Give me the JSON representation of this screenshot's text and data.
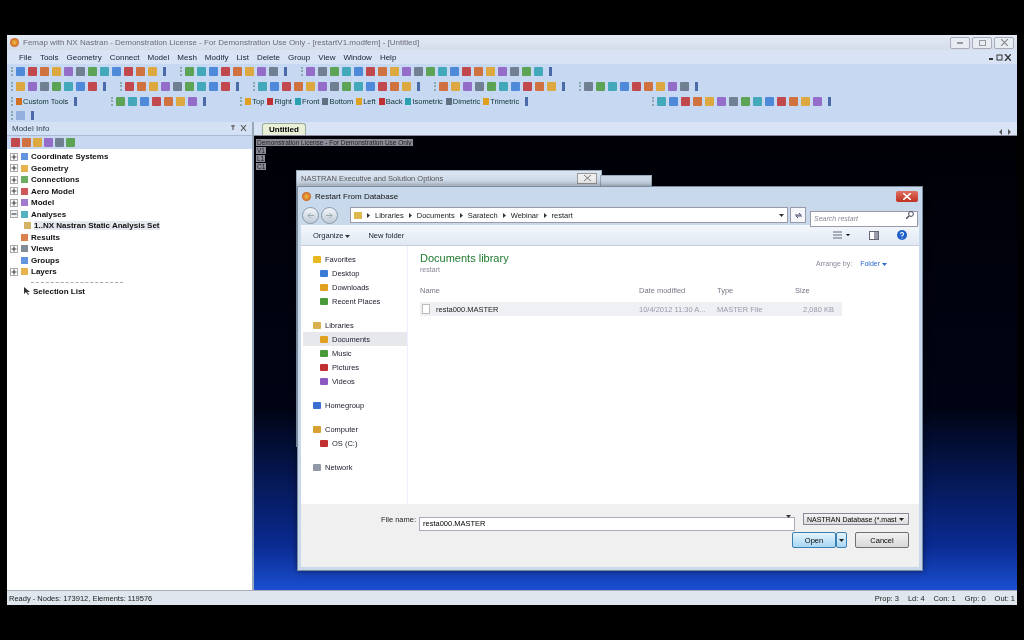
{
  "window": {
    "title": "Femap with NX Nastran - Demonstration License - For Demonstration Use Only - [restartV1.modfem] - [Untitled]"
  },
  "menu": [
    "File",
    "Tools",
    "Geometry",
    "Connect",
    "Model",
    "Mesh",
    "Modify",
    "List",
    "Delete",
    "Group",
    "View",
    "Window",
    "Help"
  ],
  "toolbar": {
    "custom_tools": "Custom Tools",
    "views": [
      "Top",
      "Right",
      "Front",
      "Bottom",
      "Left",
      "Back",
      "Isometric",
      "Dimetric",
      "Trimetric"
    ]
  },
  "model_info": {
    "title": "Model Info",
    "tree": [
      {
        "label": "Coordinate Systems",
        "expanded": false
      },
      {
        "label": "Geometry",
        "expanded": false
      },
      {
        "label": "Connections",
        "expanded": false
      },
      {
        "label": "Aero Model",
        "expanded": false
      },
      {
        "label": "Model",
        "expanded": false
      },
      {
        "label": "Analyses",
        "expanded": true,
        "children": [
          {
            "label": "1..NX Nastran Static Analysis Set",
            "selected": true
          }
        ]
      },
      {
        "label": "Results"
      },
      {
        "label": "Views",
        "expanded": false
      },
      {
        "label": "Groups"
      },
      {
        "label": "Layers",
        "expanded": false
      }
    ],
    "selection_list": "Selection List"
  },
  "graphics": {
    "tab": "Untitled",
    "overlay": [
      "Demonstration License - For Demonstration Use Only",
      "V1",
      "L1",
      "C1"
    ]
  },
  "behind_dialog": {
    "title": "NASTRAN Executive and Solution Options"
  },
  "dialog": {
    "title": "Restart From Database",
    "breadcrumb": [
      "Libraries",
      "Documents",
      "Saratech",
      "Webinar",
      "restart"
    ],
    "search": {
      "placeholder": "Search restart"
    },
    "commands": [
      {
        "label": "Organize",
        "menu": true
      },
      {
        "label": "New folder",
        "menu": false
      }
    ],
    "nav": [
      {
        "label": "Favorites",
        "children": [
          {
            "label": "Desktop",
            "selected": false
          },
          {
            "label": "Downloads",
            "selected": false
          },
          {
            "label": "Recent Places",
            "selected": false
          }
        ]
      },
      {
        "label": "Libraries",
        "children": [
          {
            "label": "Documents",
            "selected": true
          },
          {
            "label": "Music",
            "selected": false
          },
          {
            "label": "Pictures",
            "selected": false
          },
          {
            "label": "Videos",
            "selected": false
          }
        ]
      },
      {
        "label": "Homegroup"
      },
      {
        "label": "Computer",
        "children": [
          {
            "label": "OS (C:)",
            "selected": false
          }
        ]
      },
      {
        "label": "Network"
      }
    ],
    "library": {
      "title": "Documents library",
      "subtitle": "restart",
      "arrange_label": "Arrange by:",
      "arrange_value": "Folder"
    },
    "columns": [
      "Name",
      "Date modified",
      "Type",
      "Size"
    ],
    "files": [
      {
        "name": "resta000.MASTER",
        "date": "10/4/2012 11:30 A...",
        "type": "MASTER File",
        "size": "2,080 KB",
        "selected": true
      }
    ],
    "file_name": {
      "label": "File name:",
      "value": "resta000.MASTER"
    },
    "file_type": "NASTRAN Database (*.mast",
    "buttons": [
      {
        "label": "Open",
        "kind": "split",
        "default": true
      },
      {
        "label": "Cancel",
        "kind": "plain",
        "default": false
      }
    ]
  },
  "status_bar": {
    "left": "Ready - Nodes: 173912,  Elements: 119576",
    "right": [
      "Prop: 3",
      "Ld: 4",
      "Con: 1",
      "Grp: 0",
      "Out: 1"
    ]
  }
}
